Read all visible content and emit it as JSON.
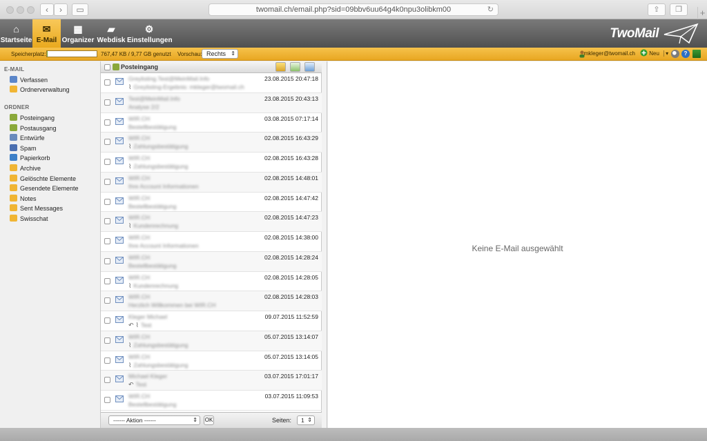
{
  "browser": {
    "url": "twomail.ch/email.php?sid=09bbv6uu64g4k0npu3olibkm00",
    "reload_icon": "reload-icon"
  },
  "nav": {
    "tabs": [
      {
        "label": "Startseite",
        "icon": "home-icon"
      },
      {
        "label": "E-Mail",
        "icon": "envelope-icon"
      },
      {
        "label": "Organizer",
        "icon": "calendar-icon"
      },
      {
        "label": "Webdisk",
        "icon": "folder-icon"
      },
      {
        "label": "Einstellungen",
        "icon": "gear-icon"
      }
    ],
    "brand": "TwoMail",
    "active_color": "#f0b534"
  },
  "infobar": {
    "quota_label": "Speicherplatz:",
    "quota_text": "767,47 KB / 9,77 GB genutzt",
    "quota_fraction": 0.0001,
    "preview_label": "Vorschau:",
    "preview_value": "Rechts",
    "user": "mkleger@twomail.ch",
    "new_label": "Neu"
  },
  "sidebar": {
    "email_head": "E-MAIL",
    "email_items": [
      {
        "label": "Verfassen",
        "icon": "compose-icon"
      },
      {
        "label": "Ordnerverwaltung",
        "icon": "folder-manage-icon"
      }
    ],
    "folders_head": "ORDNER",
    "folders": [
      {
        "label": "Posteingang",
        "icon": "inbox-icon",
        "color": "#8aa83a"
      },
      {
        "label": "Postausgang",
        "icon": "outbox-icon",
        "color": "#8aa83a"
      },
      {
        "label": "Entwürfe",
        "icon": "drafts-icon",
        "color": "#6a8bbd"
      },
      {
        "label": "Spam",
        "icon": "spam-icon",
        "color": "#4b6fb0"
      },
      {
        "label": "Papierkorb",
        "icon": "trash-icon",
        "color": "#3c7fc8"
      },
      {
        "label": "Archive",
        "icon": "folder-icon",
        "color": "#f0b534"
      },
      {
        "label": "Gelöschte Elemente",
        "icon": "folder-icon",
        "color": "#f0b534"
      },
      {
        "label": "Gesendete Elemente",
        "icon": "folder-icon",
        "color": "#f0b534"
      },
      {
        "label": "Notes",
        "icon": "folder-icon",
        "color": "#f0b534"
      },
      {
        "label": "Sent Messages",
        "icon": "folder-icon",
        "color": "#f0b534"
      },
      {
        "label": "Swisschat",
        "icon": "folder-icon",
        "color": "#f0b534"
      }
    ]
  },
  "list": {
    "title": "Posteingang",
    "messages": [
      {
        "sender": "Greylisting.Test@MeinMail.Info",
        "date": "23.08.2015 20:47:18",
        "subject": "Greylisting-Ergebnis: mkleger@twomail.ch",
        "clip": true,
        "reply": false
      },
      {
        "sender": "Test@MeinMail.Info",
        "date": "23.08.2015 20:43:13",
        "subject": "Analyse 2/2",
        "clip": false,
        "reply": false
      },
      {
        "sender": "WIR.CH",
        "date": "03.08.2015 07:17:14",
        "subject": "Bestellbestätigung",
        "clip": false,
        "reply": false
      },
      {
        "sender": "WIR.CH",
        "date": "02.08.2015 16:43:29",
        "subject": "Zahlungsbestätigung",
        "clip": true,
        "reply": false
      },
      {
        "sender": "WIR.CH",
        "date": "02.08.2015 16:43:28",
        "subject": "Zahlungsbestätigung",
        "clip": true,
        "reply": false
      },
      {
        "sender": "WIR.CH",
        "date": "02.08.2015 14:48:01",
        "subject": "Ihre Account Informationen",
        "clip": false,
        "reply": false
      },
      {
        "sender": "WIR.CH",
        "date": "02.08.2015 14:47:42",
        "subject": "Bestellbestätigung",
        "clip": false,
        "reply": false
      },
      {
        "sender": "WIR.CH",
        "date": "02.08.2015 14:47:23",
        "subject": "Kundenrechnung",
        "clip": true,
        "reply": false
      },
      {
        "sender": "WIR.CH",
        "date": "02.08.2015 14:38:00",
        "subject": "Ihre Account Informationen",
        "clip": false,
        "reply": false
      },
      {
        "sender": "WIR.CH",
        "date": "02.08.2015 14:28:24",
        "subject": "Bestellbestätigung",
        "clip": false,
        "reply": false
      },
      {
        "sender": "WIR.CH",
        "date": "02.08.2015 14:28:05",
        "subject": "Kundenrechnung",
        "clip": true,
        "reply": false
      },
      {
        "sender": "WIR.CH",
        "date": "02.08.2015 14:28:03",
        "subject": "Herzlich Willkommen bei WIR.CH",
        "clip": false,
        "reply": false
      },
      {
        "sender": "Kleger Michael",
        "date": "09.07.2015 11:52:59",
        "subject": "Test",
        "clip": true,
        "reply": true
      },
      {
        "sender": "WIR.CH",
        "date": "05.07.2015 13:14:07",
        "subject": "Zahlungsbestätigung",
        "clip": true,
        "reply": false
      },
      {
        "sender": "WIR.CH",
        "date": "05.07.2015 13:14:05",
        "subject": "Zahlungsbestätigung",
        "clip": true,
        "reply": false
      },
      {
        "sender": "Michael Kleger",
        "date": "03.07.2015 17:01:17",
        "subject": "Test",
        "clip": false,
        "reply": true
      },
      {
        "sender": "WIR.CH",
        "date": "03.07.2015 11:09:53",
        "subject": "Bestellbestätigung",
        "clip": false,
        "reply": false
      }
    ],
    "action_placeholder": "------ Aktion ------",
    "ok_label": "OK",
    "pages_label": "Seiten:",
    "page_value": "1"
  },
  "preview": {
    "empty_text": "Keine E-Mail ausgewählt"
  }
}
